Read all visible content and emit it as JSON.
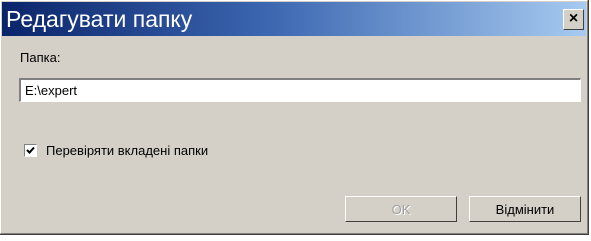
{
  "window": {
    "title": "Редагувати папку",
    "close_symbol": "×"
  },
  "folder": {
    "label": "Папка:",
    "value": "E:\\expert"
  },
  "options": {
    "check_subfolders_label": "Перевіряти вкладені папки",
    "check_subfolders_checked": true
  },
  "buttons": {
    "ok_label": "OK",
    "ok_enabled": false,
    "cancel_label": "Відмінити"
  },
  "colors": {
    "titlebar_start": "#0a246a",
    "titlebar_end": "#a6caf0",
    "face": "#d4d0c8"
  }
}
